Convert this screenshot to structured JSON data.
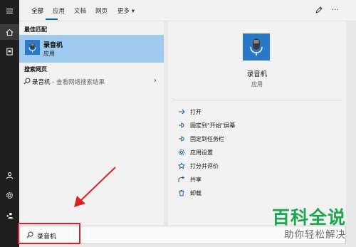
{
  "tabs": [
    {
      "label": "全部",
      "active": true
    },
    {
      "label": "应用"
    },
    {
      "label": "文档"
    },
    {
      "label": "网页"
    },
    {
      "label": "更多 ▾"
    }
  ],
  "left_panel": {
    "best_match_label": "最佳匹配",
    "best_match": {
      "title": "录音机",
      "subtitle": "应用",
      "icon": "microphone-icon"
    },
    "web_label": "搜索网页",
    "web_result": {
      "query": "录音机",
      "suffix": " - 查看网络搜索结果"
    }
  },
  "right_panel": {
    "app_name": "录音机",
    "app_type": "应用",
    "actions": [
      {
        "label": "打开",
        "icon": "open-icon"
      },
      {
        "label": "固定到\"开始\"屏幕",
        "icon": "pin-start-icon"
      },
      {
        "label": "固定到任务栏",
        "icon": "pin-taskbar-icon"
      },
      {
        "label": "应用设置",
        "icon": "settings-icon"
      },
      {
        "label": "打分并评价",
        "icon": "star-icon"
      },
      {
        "label": "共享",
        "icon": "share-icon"
      },
      {
        "label": "卸载",
        "icon": "trash-icon"
      }
    ]
  },
  "search": {
    "value": "录音机",
    "icon": "search-icon"
  },
  "watermark": {
    "title": "百科全说",
    "subtitle": "助你轻松解决"
  },
  "colors": {
    "accent": "#0067b8",
    "selection": "#9ecaf0",
    "tile": "#2a78c8",
    "highlight_box": "#e02020",
    "watermark_green": "#1aa64a"
  }
}
